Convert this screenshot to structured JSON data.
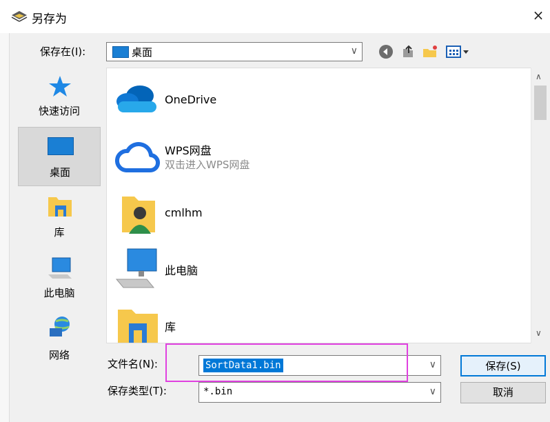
{
  "window": {
    "title": "另存为",
    "close_glyph": "×",
    "icon": "save-dialog-icon"
  },
  "toolbar": {
    "save_in_label": "保存在(I):",
    "save_in_value": "桌面",
    "icons": [
      "back-icon",
      "up-folder-icon",
      "new-folder-icon",
      "view-menu-icon"
    ]
  },
  "places": [
    {
      "label": "快速访问",
      "icon": "star-icon",
      "selected": false
    },
    {
      "label": "桌面",
      "icon": "desktop-icon",
      "selected": true
    },
    {
      "label": "库",
      "icon": "library-icon",
      "selected": false
    },
    {
      "label": "此电脑",
      "icon": "computer-icon",
      "selected": false
    },
    {
      "label": "网络",
      "icon": "network-icon",
      "selected": false
    }
  ],
  "items": [
    {
      "name": "OneDrive",
      "subtitle": "",
      "icon": "onedrive-icon"
    },
    {
      "name": "WPS网盘",
      "subtitle": "双击进入WPS网盘",
      "icon": "wps-cloud-icon"
    },
    {
      "name": "cmlhm",
      "subtitle": "",
      "icon": "user-folder-icon"
    },
    {
      "name": "此电脑",
      "subtitle": "",
      "icon": "computer-icon"
    },
    {
      "name": "库",
      "subtitle": "",
      "icon": "library-icon"
    }
  ],
  "form": {
    "filename_label": "文件名(N):",
    "filename_value": "SortData1.bin",
    "filetype_label": "保存类型(T):",
    "filetype_value": "*.bin"
  },
  "buttons": {
    "save": "保存(S)",
    "cancel": "取消"
  },
  "colors": {
    "accent": "#0078d7",
    "highlight": "#e040e0",
    "desktop_blue": "#1a7fd4",
    "folder_yellow": "#f6c84c"
  }
}
